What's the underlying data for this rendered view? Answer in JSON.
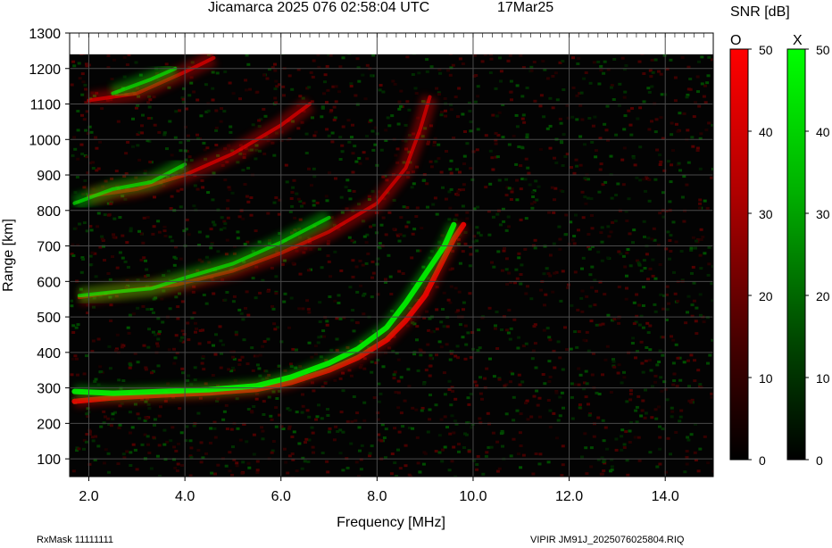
{
  "header": {
    "title": "Jicamarca 2025 076 02:58:04 UTC",
    "date": "17Mar25"
  },
  "footer": {
    "rxmask": "RxMask 11111111",
    "file": "VIPIR  JM91J_2025076025804.RIQ"
  },
  "chart_data": {
    "type": "heatmap",
    "title": "Jicamarca 2025 076 02:58:04 UTC",
    "xlabel": "Frequency [MHz]",
    "ylabel": "Range [km]",
    "xlim": [
      1.6,
      15.0
    ],
    "ylim": [
      50,
      1300
    ],
    "x_ticks": [
      "2.0",
      "4.0",
      "6.0",
      "8.0",
      "10.0",
      "12.0",
      "14.0"
    ],
    "x_tick_values": [
      2,
      4,
      6,
      8,
      10,
      12,
      14
    ],
    "y_ticks": [
      "100",
      "200",
      "300",
      "400",
      "500",
      "600",
      "700",
      "800",
      "900",
      "1000",
      "1100",
      "1200",
      "1300"
    ],
    "y_tick_values": [
      100,
      200,
      300,
      400,
      500,
      600,
      700,
      800,
      900,
      1000,
      1100,
      1200,
      1300
    ],
    "grid": true,
    "colorbar": {
      "label": "SNR [dB]",
      "range": [
        0,
        50
      ],
      "ticks": [
        "0",
        "10",
        "20",
        "30",
        "40",
        "50"
      ],
      "tick_values": [
        0,
        10,
        20,
        30,
        40,
        50
      ]
    },
    "series": [
      {
        "name": "O",
        "color": "#ff0000",
        "traces": [
          [
            [
              1.7,
              262
            ],
            [
              2.5,
              272
            ],
            [
              3.5,
              280
            ],
            [
              4.5,
              286
            ],
            [
              5.5,
              296
            ],
            [
              6.2,
              315
            ],
            [
              7.0,
              350
            ],
            [
              7.6,
              385
            ],
            [
              8.2,
              435
            ],
            [
              8.6,
              490
            ],
            [
              9.0,
              560
            ],
            [
              9.3,
              640
            ],
            [
              9.6,
              720
            ],
            [
              9.8,
              760
            ]
          ],
          [
            [
              1.8,
              555
            ],
            [
              2.8,
              575
            ],
            [
              3.8,
              590
            ],
            [
              5.0,
              630
            ],
            [
              6.0,
              680
            ],
            [
              7.0,
              740
            ],
            [
              8.0,
              820
            ],
            [
              8.6,
              920
            ],
            [
              8.9,
              1030
            ],
            [
              9.1,
              1120
            ]
          ],
          [
            [
              2.0,
              840
            ],
            [
              3.0,
              860
            ],
            [
              4.0,
              900
            ],
            [
              5.0,
              960
            ],
            [
              6.0,
              1040
            ],
            [
              6.6,
              1100
            ]
          ],
          [
            [
              2.0,
              1110
            ],
            [
              3.0,
              1130
            ],
            [
              4.0,
              1190
            ],
            [
              4.6,
              1230
            ]
          ]
        ]
      },
      {
        "name": "X",
        "color": "#00ff00",
        "traces": [
          [
            [
              1.7,
              290
            ],
            [
              2.5,
              285
            ],
            [
              3.5,
              290
            ],
            [
              4.5,
              295
            ],
            [
              5.5,
              306
            ],
            [
              6.2,
              330
            ],
            [
              7.0,
              370
            ],
            [
              7.6,
              410
            ],
            [
              8.2,
              470
            ],
            [
              8.6,
              540
            ],
            [
              9.0,
              620
            ],
            [
              9.4,
              700
            ],
            [
              9.6,
              760
            ]
          ],
          [
            [
              1.8,
              560
            ],
            [
              2.5,
              570
            ],
            [
              3.3,
              580
            ],
            [
              4.0,
              610
            ],
            [
              5.0,
              650
            ],
            [
              6.0,
              710
            ],
            [
              7.0,
              780
            ]
          ],
          [
            [
              1.7,
              820
            ],
            [
              2.5,
              860
            ],
            [
              3.3,
              880
            ],
            [
              4.0,
              930
            ]
          ],
          [
            [
              2.5,
              1130
            ],
            [
              3.3,
              1170
            ],
            [
              3.8,
              1200
            ]
          ]
        ]
      }
    ]
  }
}
